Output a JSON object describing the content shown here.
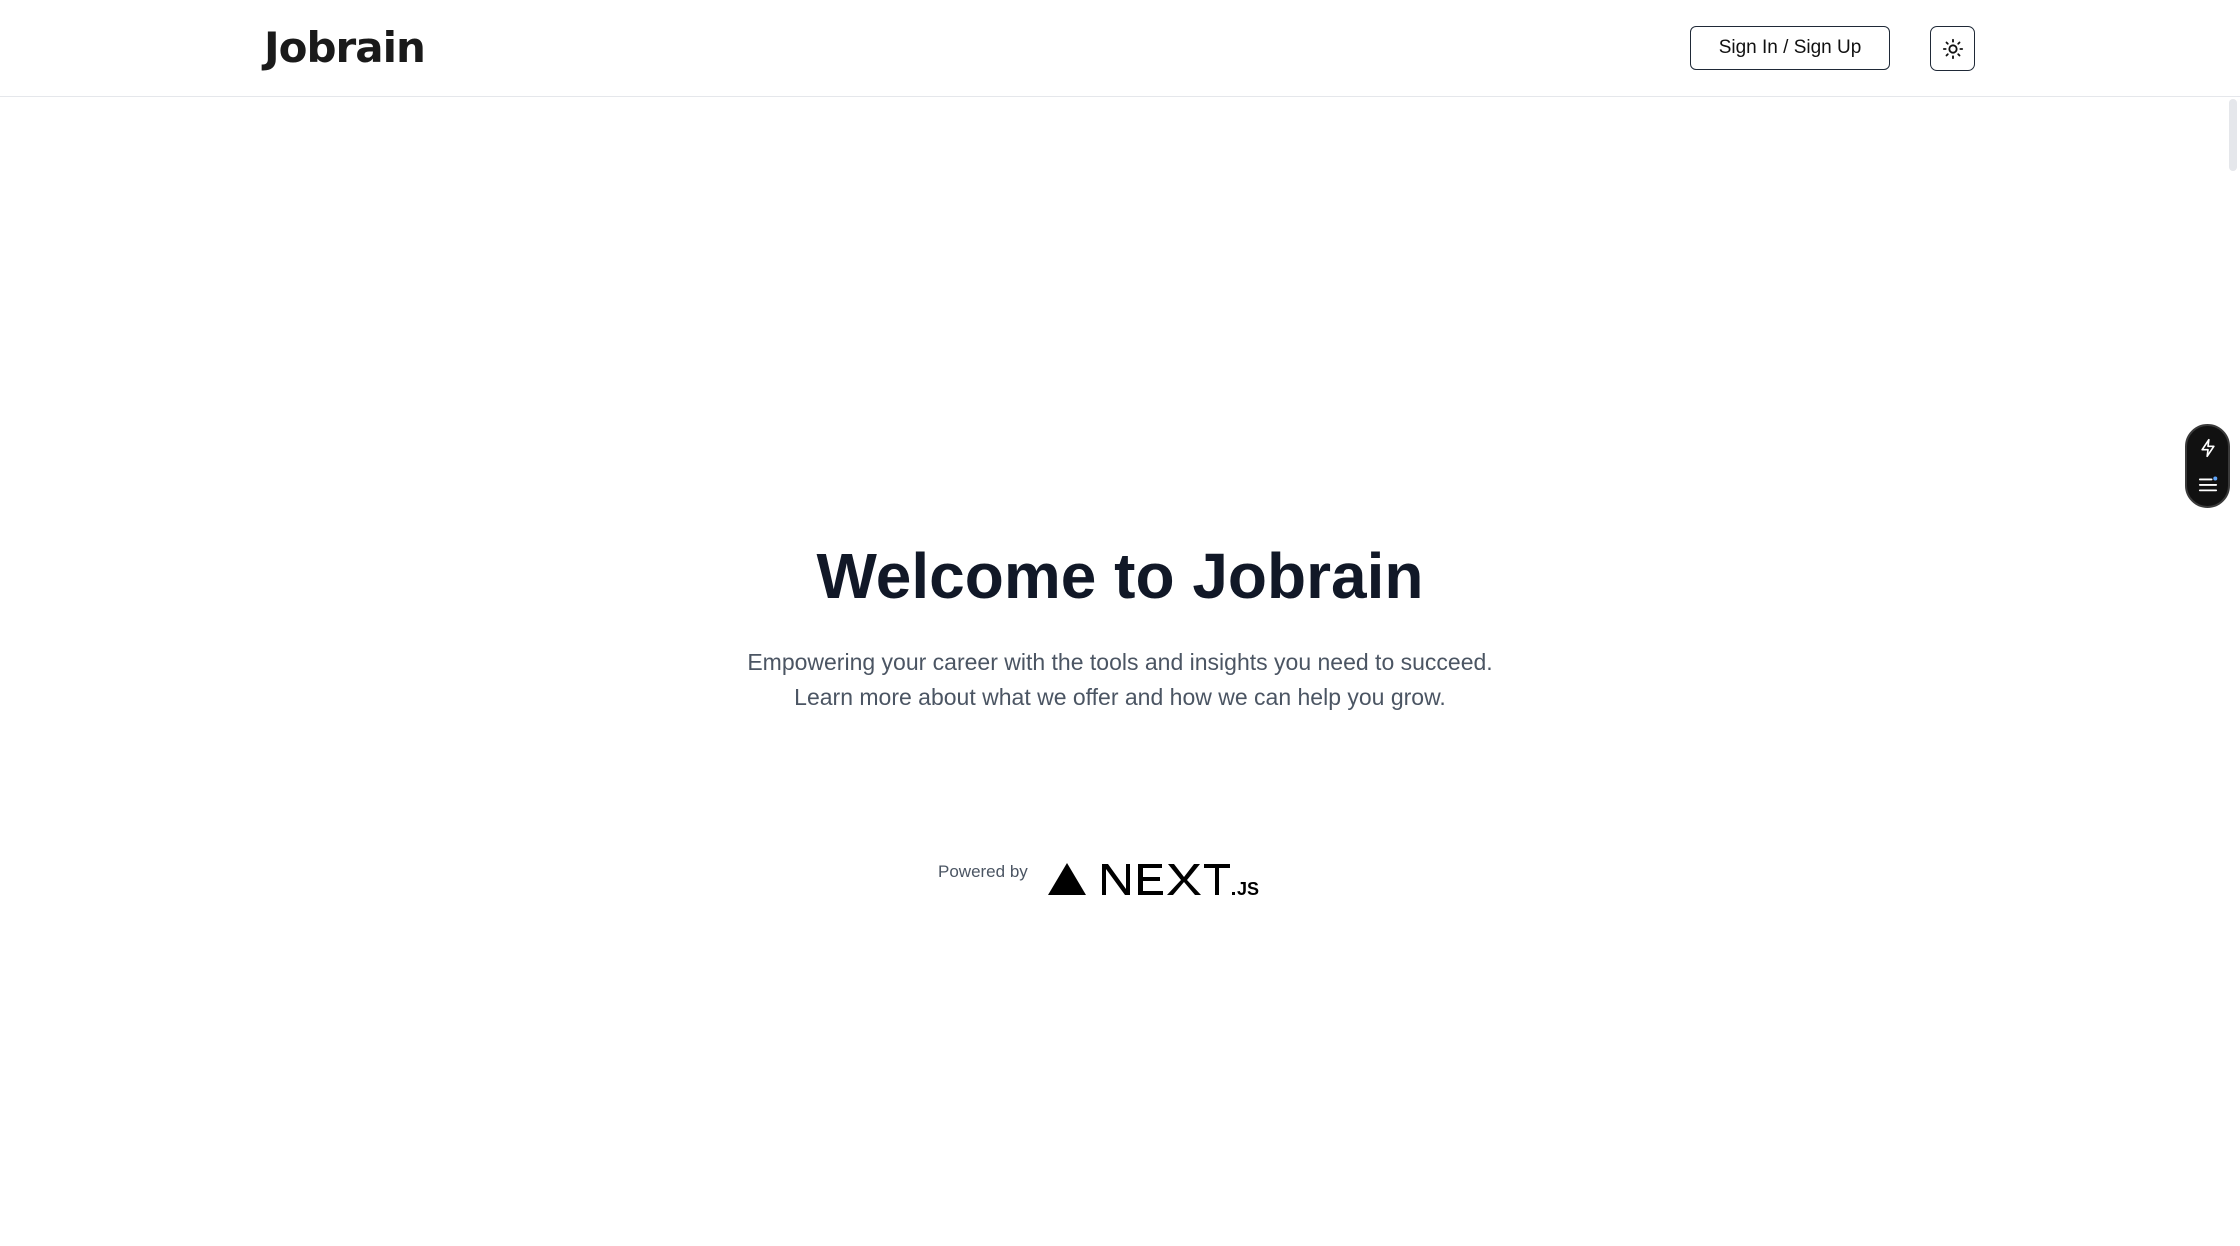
{
  "header": {
    "logo_text": "Jobrain",
    "signin_label": "Sign In / Sign Up",
    "theme_toggle_icon": "sun-icon"
  },
  "hero": {
    "title": "Welcome to Jobrain",
    "subtitle_line1": "Empowering your career with the tools and insights you need to succeed.",
    "subtitle_line2": "Learn more about what we offer and how we can help you grow."
  },
  "footer": {
    "powered_by_label": "Powered by",
    "framework_logo": "nextjs-logo",
    "framework_logo_text": "NEXT.JS"
  },
  "floating_toolbar": {
    "icons": [
      "lightning-icon",
      "menu-list-icon"
    ]
  },
  "colors": {
    "title": "#111827",
    "subtitle": "#4b5563",
    "border": "#e5e7eb",
    "toolbar_bg": "#111111",
    "badge_accent": "#60a5fa"
  }
}
